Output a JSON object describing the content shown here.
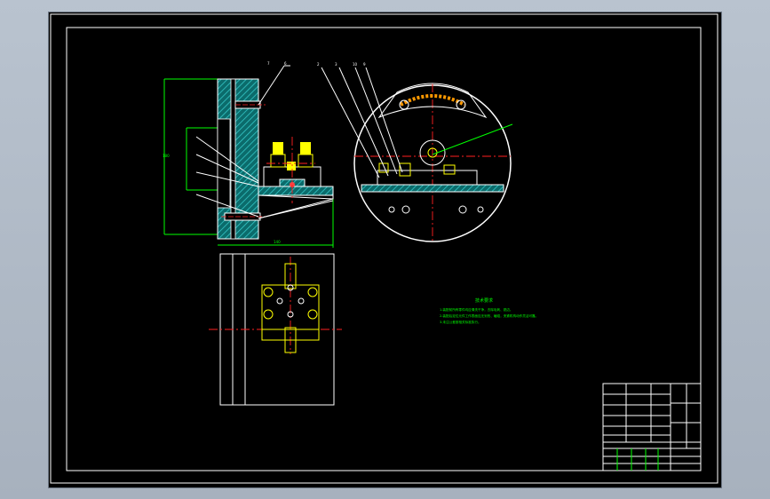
{
  "technical_notes": {
    "title": "技术要求",
    "lines": [
      "1.装配前所有零件均应清洗干净，去除毛刺、锐边。",
      "2.装配后定位元件工作表面应无划伤、磕碰，夹紧机构动作灵活可靠。",
      "3.未注公差按相关标准执行。"
    ]
  },
  "colors": {
    "background": "#000000",
    "outline": "#ffffff",
    "dimension": "#00ff00",
    "centerline": "#ff2020",
    "hidden": "#ffff00",
    "section_hatch": "#2aa6a6",
    "window_chrome": "#b4bfcc"
  }
}
